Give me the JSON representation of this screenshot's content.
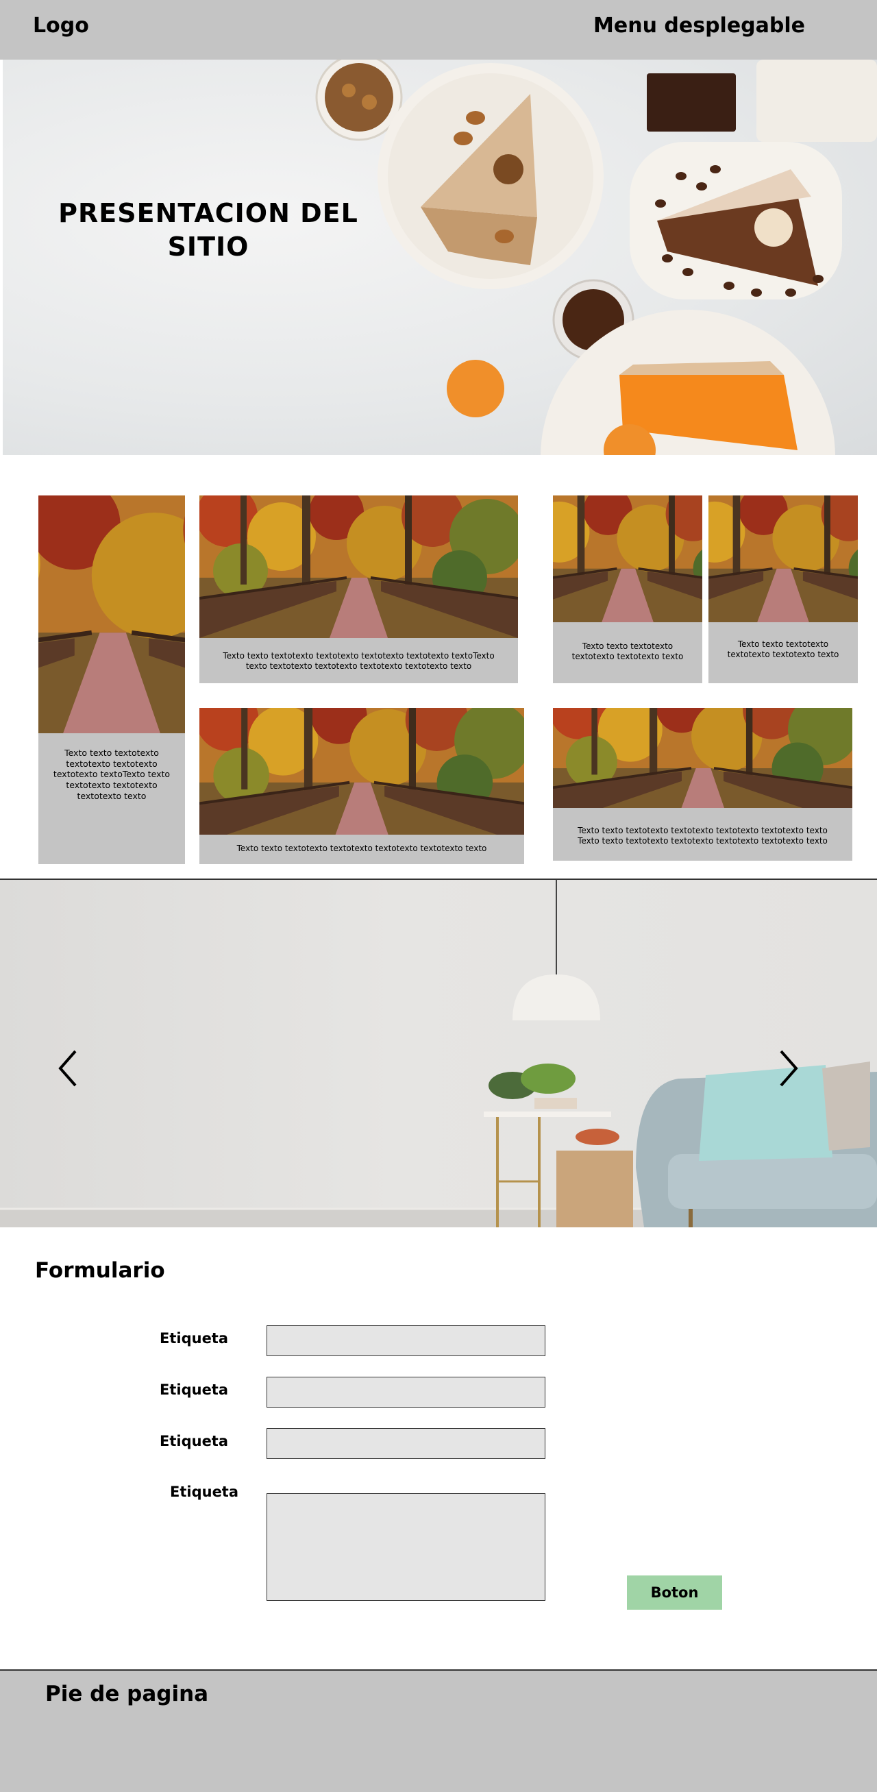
{
  "header": {
    "logo": "Logo",
    "menu": "Menu desplegable"
  },
  "hero": {
    "title": "PRESENTACION DEL SITIO"
  },
  "gallery": {
    "cards": [
      {
        "caption": "Texto texto textotexto textotexto textotexto textotexto textoTexto texto textotexto textotexto textotexto texto"
      },
      {
        "caption": "Texto texto textotexto textotexto textotexto textotexto textoTexto texto textotexto textotexto textotexto textotexto texto"
      },
      {
        "caption": "Texto texto textotexto textotexto textotexto texto"
      },
      {
        "caption": "Texto texto textotexto textotexto textotexto texto"
      },
      {
        "caption": "Texto texto textotexto textotexto textotexto textotexto texto"
      },
      {
        "caption": "Texto texto textotexto textotexto textotexto textotexto texto Texto texto textotexto textotexto textotexto textotexto texto"
      }
    ]
  },
  "slider": {
    "prev_icon": "chevron-left-icon",
    "next_icon": "chevron-right-icon"
  },
  "form": {
    "title": "Formulario",
    "fields": [
      {
        "label": "Etiqueta",
        "value": ""
      },
      {
        "label": "Etiqueta",
        "value": ""
      },
      {
        "label": "Etiqueta",
        "value": ""
      },
      {
        "label": "Etiqueta",
        "value": ""
      }
    ],
    "button_label": "Boton"
  },
  "footer": {
    "title": "Pie de pagina"
  },
  "colors": {
    "header_bg": "#c4c4c4",
    "button_bg": "#a0d4a6",
    "field_bg": "#e5e5e5",
    "card_bg": "#c4c4c4"
  }
}
